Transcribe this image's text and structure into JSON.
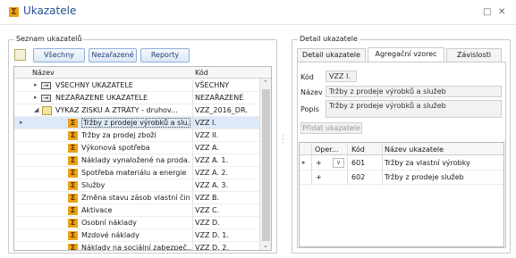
{
  "window": {
    "title": "Ukazatele",
    "maximize": "□",
    "close": "✕"
  },
  "left_group": {
    "title": "Seznam ukazatelů",
    "buttons": [
      "Všechny",
      "Nezařazené",
      "Reporty"
    ],
    "columns": {
      "name": "Název",
      "code": "Kód"
    },
    "rows": [
      {
        "kind": "arrow",
        "name": "VŠECHNY UKAZATELE",
        "code": "VŠECHNY",
        "level": 0
      },
      {
        "kind": "arrow",
        "name": "NEZAŘAZENÉ UKAZATELE",
        "code": "NEZAŘAZENÉ",
        "level": 0
      },
      {
        "kind": "folder",
        "name": "VÝKAZ ZISKU A ZTRÁTY - druhov...",
        "code": "VZZ_2016_DR.",
        "level": 0,
        "expanded": true
      },
      {
        "kind": "sigma",
        "name": "Tržby z prodeje výrobků a slu...",
        "code": "VZZ I.",
        "level": 1,
        "selected": true
      },
      {
        "kind": "sigma",
        "name": "Tržby za prodej zboží",
        "code": "VZZ II.",
        "level": 1
      },
      {
        "kind": "sigma",
        "name": "Výkonová spotřeba",
        "code": "VZZ A.",
        "level": 1
      },
      {
        "kind": "sigma",
        "name": "Náklady vynaložené na proda...",
        "code": "VZZ A. 1.",
        "level": 1
      },
      {
        "kind": "sigma",
        "name": "Spotřeba materiálu a energie",
        "code": "VZZ A. 2.",
        "level": 1
      },
      {
        "kind": "sigma",
        "name": "Služby",
        "code": "VZZ A. 3.",
        "level": 1
      },
      {
        "kind": "sigma",
        "name": "Změna stavu zásob vlastní čin...",
        "code": "VZZ B.",
        "level": 1
      },
      {
        "kind": "sigma",
        "name": "Aktivace",
        "code": "VZZ C.",
        "level": 1
      },
      {
        "kind": "sigma",
        "name": "Osobní náklady",
        "code": "VZZ D.",
        "level": 1
      },
      {
        "kind": "sigma",
        "name": "Mzdové náklady",
        "code": "VZZ D. 1.",
        "level": 1
      },
      {
        "kind": "sigma",
        "name": "Náklady na sociální zabezpeč...",
        "code": "VZZ D. 2.",
        "level": 1
      }
    ]
  },
  "right_group": {
    "title": "Detail ukazatele",
    "tabs": [
      "Detail ukazatele",
      "Agregační vzorec",
      "Závislosti"
    ],
    "active_tab": 1,
    "kod_label": "Kód",
    "kod_value": "VZZ I.",
    "nazev_label": "Název",
    "nazev_value": "Tržby z prodeje výrobků a služeb",
    "popis_label": "Popis",
    "popis_value": "Tržby z prodeje výrobků a služeb",
    "add_button": "Přidat ukazatele",
    "grid_columns": [
      "Oper...",
      "Kód",
      "Název ukazatele"
    ],
    "grid_rows": [
      {
        "op": "+",
        "code": "601",
        "name": "Tržby za vlastní výrobky"
      },
      {
        "op": "+",
        "code": "602",
        "name": "Tržby z prodeje služeb"
      }
    ]
  },
  "colors": {
    "accent": "#1f4f8f",
    "sigma": "#e8a317",
    "selection": "#dde9f8"
  }
}
